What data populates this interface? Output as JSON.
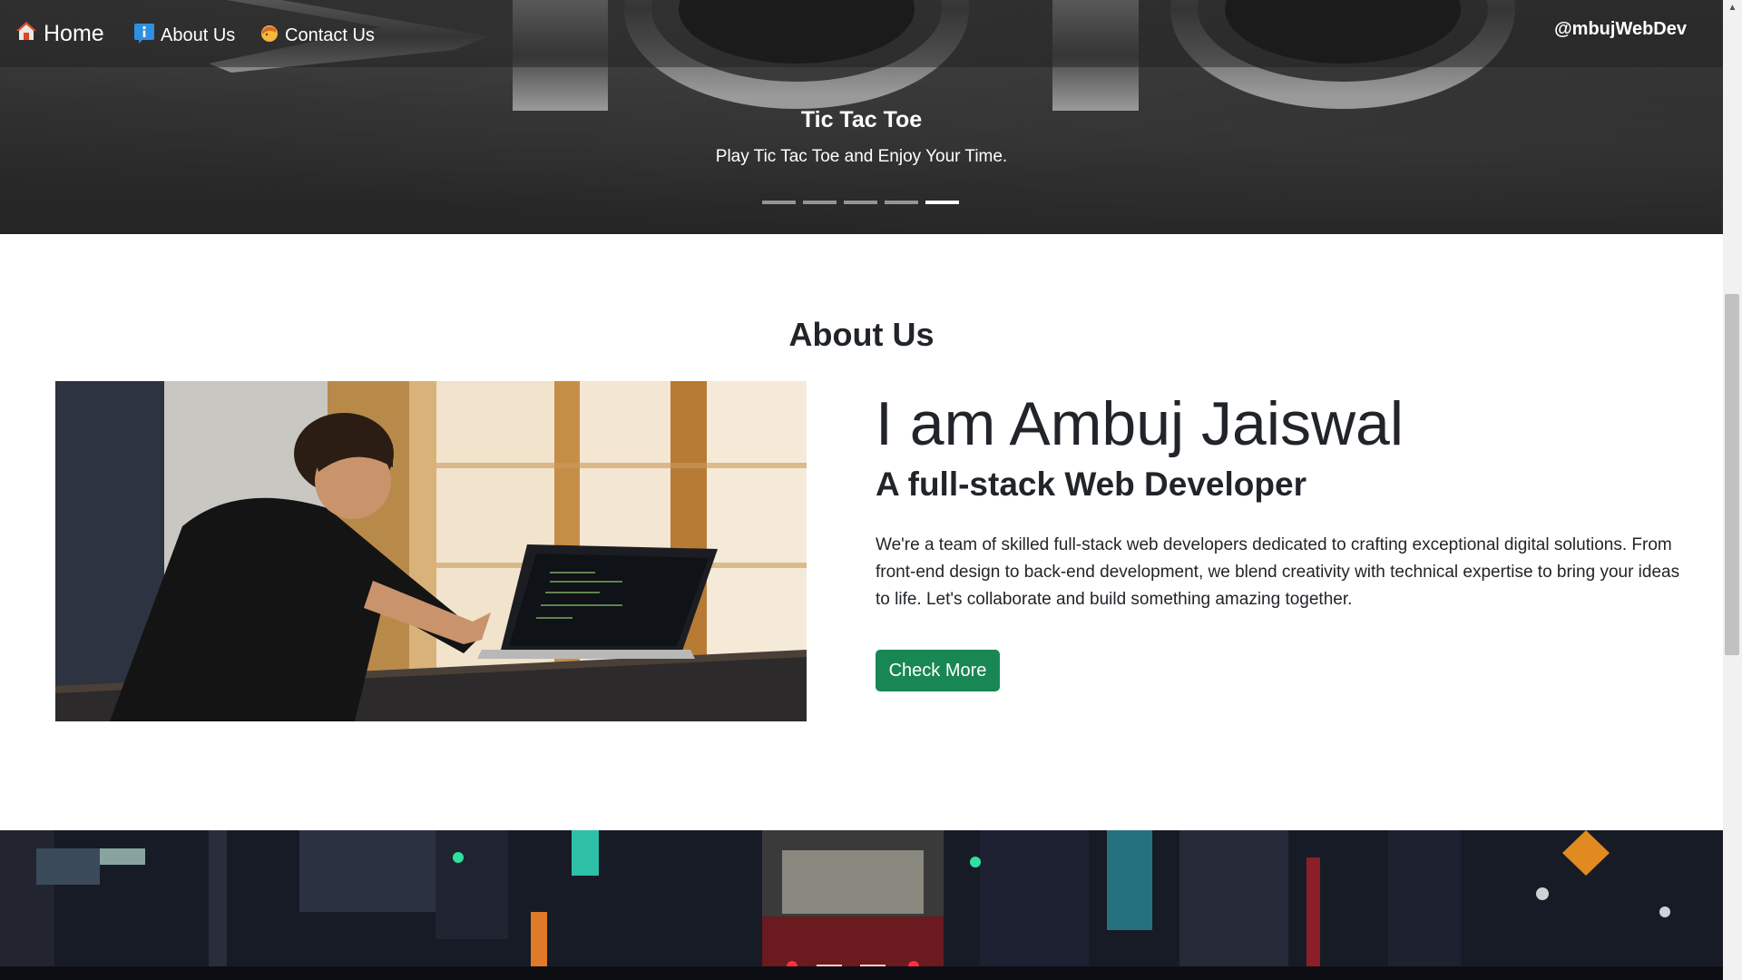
{
  "nav": {
    "home_label": "Home",
    "about_label": "About Us",
    "contact_label": "Contact Us",
    "brand": "@mbujWebDev",
    "home_icon": "house-icon",
    "about_icon": "info-icon",
    "contact_icon": "person-icon"
  },
  "hero": {
    "title": "Tic Tac Toe",
    "subtitle": "Play Tic Tac Toe and Enjoy Your Time.",
    "slide_count": 5,
    "active_slide": 5
  },
  "about": {
    "heading": "About Us",
    "name": "I am Ambuj Jaiswal",
    "role": "A full-stack Web Developer",
    "description": "We're a team of skilled full-stack web developers dedicated to crafting exceptional digital solutions. From front-end design to back-end development, we blend creativity with technical expertise to bring your ideas to life. Let's collaborate and build something amazing together.",
    "button_label": "Check More"
  },
  "colors": {
    "accent_button": "#198754",
    "text": "#212529"
  }
}
